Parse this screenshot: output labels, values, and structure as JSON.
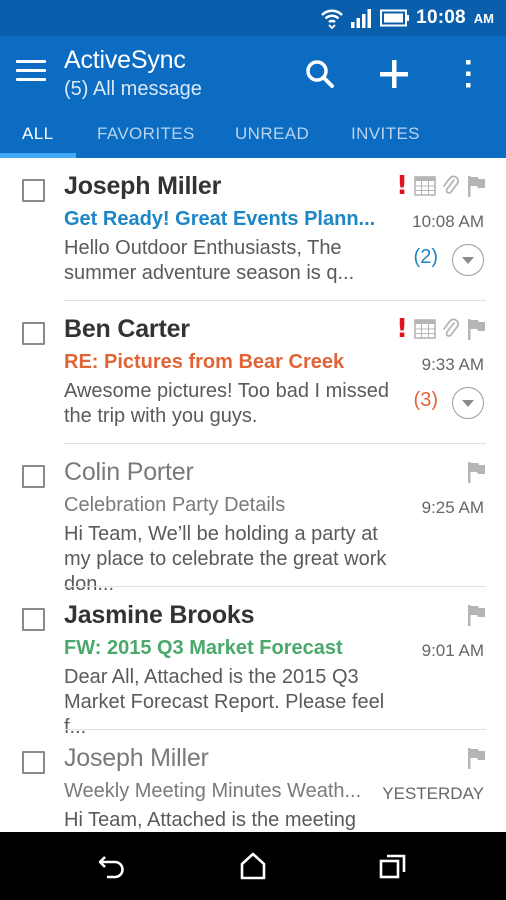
{
  "status_bar": {
    "time": "10:08",
    "ampm": "AM"
  },
  "app_bar": {
    "title": "ActiveSync",
    "subtitle": "(5) All message"
  },
  "tabs": [
    {
      "label": "ALL",
      "active": true
    },
    {
      "label": "FAVORITES",
      "active": false
    },
    {
      "label": "UNREAD",
      "active": false
    },
    {
      "label": "INVITES",
      "active": false
    }
  ],
  "colors": {
    "status_bar": "#0a5fad",
    "app_bar": "#0b6cc2",
    "tab_indicator": "#3fa9f5",
    "important": "#e0141e"
  },
  "messages": [
    {
      "sender": "Joseph Miller",
      "subject": "Get Ready! Great Events Plann...",
      "time": "10:08 AM",
      "preview": "Hello Outdoor Enthusiasts, The summer adventure season is q...",
      "thread_count": "(2)",
      "important": true,
      "icons": [
        "important-icon",
        "calendar-icon",
        "attachment-icon",
        "flag-icon"
      ]
    },
    {
      "sender": "Ben Carter",
      "subject": "RE: Pictures from Bear Creek",
      "time": "9:33 AM",
      "preview": "Awesome pictures! Too bad I missed the trip with you guys.",
      "thread_count": "(3)",
      "important": true,
      "icons": [
        "important-icon",
        "calendar-icon",
        "attachment-icon",
        "flag-icon"
      ]
    },
    {
      "sender": "Colin Porter",
      "subject": "Celebration Party Details",
      "time": "9:25 AM",
      "preview": "Hi Team, We’ll be holding a party at my place to celebrate the great work don...",
      "icons": [
        "flag-icon"
      ]
    },
    {
      "sender": "Jasmine Brooks",
      "subject": "FW: 2015 Q3 Market Forecast",
      "time": "9:01 AM",
      "preview": "Dear All, Attached is the 2015 Q3 Market Forecast Report. Please feel f...",
      "icons": [
        "flag-icon"
      ]
    },
    {
      "sender": "Joseph Miller",
      "subject": "Weekly Meeting Minutes Weath...",
      "time": "YESTERDAY",
      "preview": "Hi Team, Attached is the meeting",
      "icons": [
        "flag-icon"
      ]
    }
  ],
  "nav_bar": {
    "buttons": [
      "back-icon",
      "home-icon",
      "recents-icon"
    ]
  }
}
